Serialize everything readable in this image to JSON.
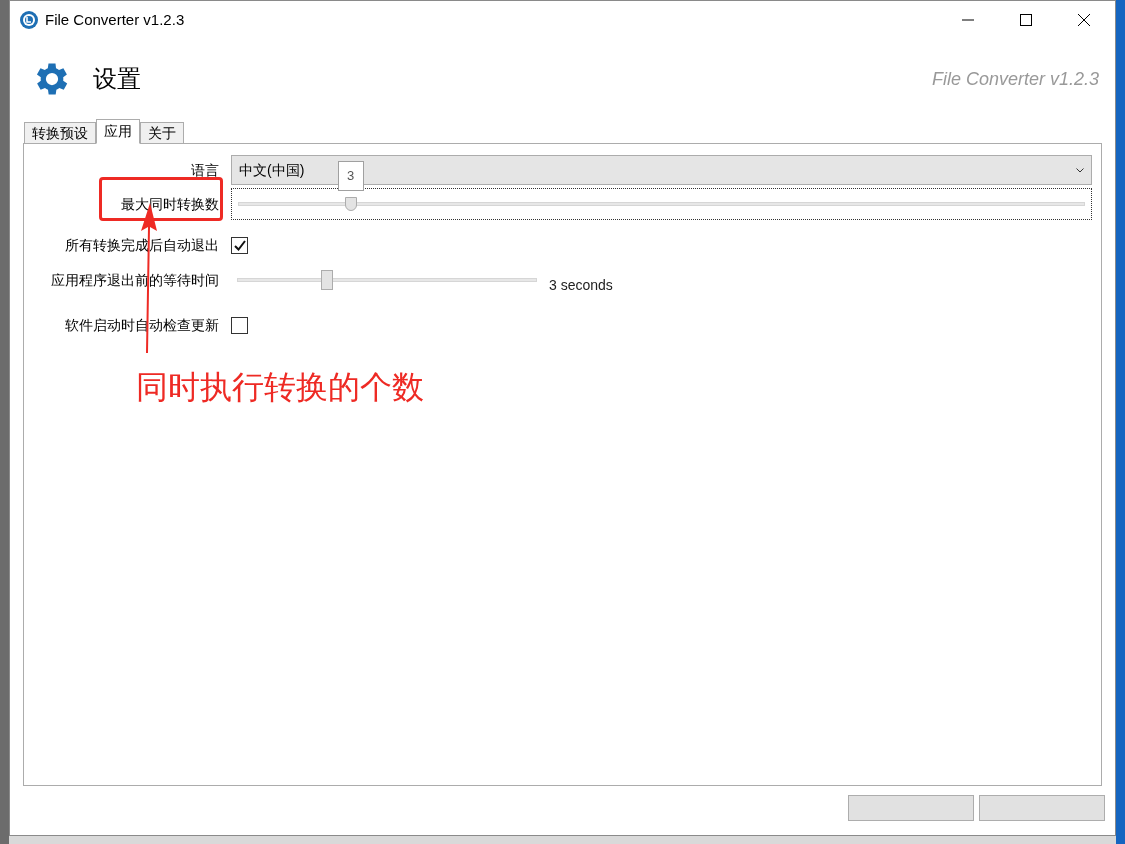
{
  "window": {
    "title": "File Converter v1.2.3"
  },
  "header": {
    "title": "设置",
    "brand": "File Converter v1.2.3"
  },
  "tabs": [
    {
      "label": "转换预设",
      "selected": false
    },
    {
      "label": "应用",
      "selected": true
    },
    {
      "label": "关于",
      "selected": false
    }
  ],
  "settings": [
    {
      "kind": "dropdown",
      "label": "语言",
      "value": "中文(中国)"
    },
    {
      "kind": "slider",
      "label": "最大同时转换数",
      "level": 0.133,
      "tooltip": "3",
      "focused": true
    },
    {
      "kind": "checkbox",
      "label": "所有转换完成后自动退出",
      "checked": true
    },
    {
      "kind": "slider",
      "label": "应用程序退出前的等待时间",
      "level": 0.3,
      "reading": "3 seconds",
      "focused": false
    },
    {
      "kind": "checkbox",
      "label": "软件启动时自动检查更新",
      "checked": false
    }
  ],
  "annotation": {
    "text": "同时执行转换的个数"
  }
}
